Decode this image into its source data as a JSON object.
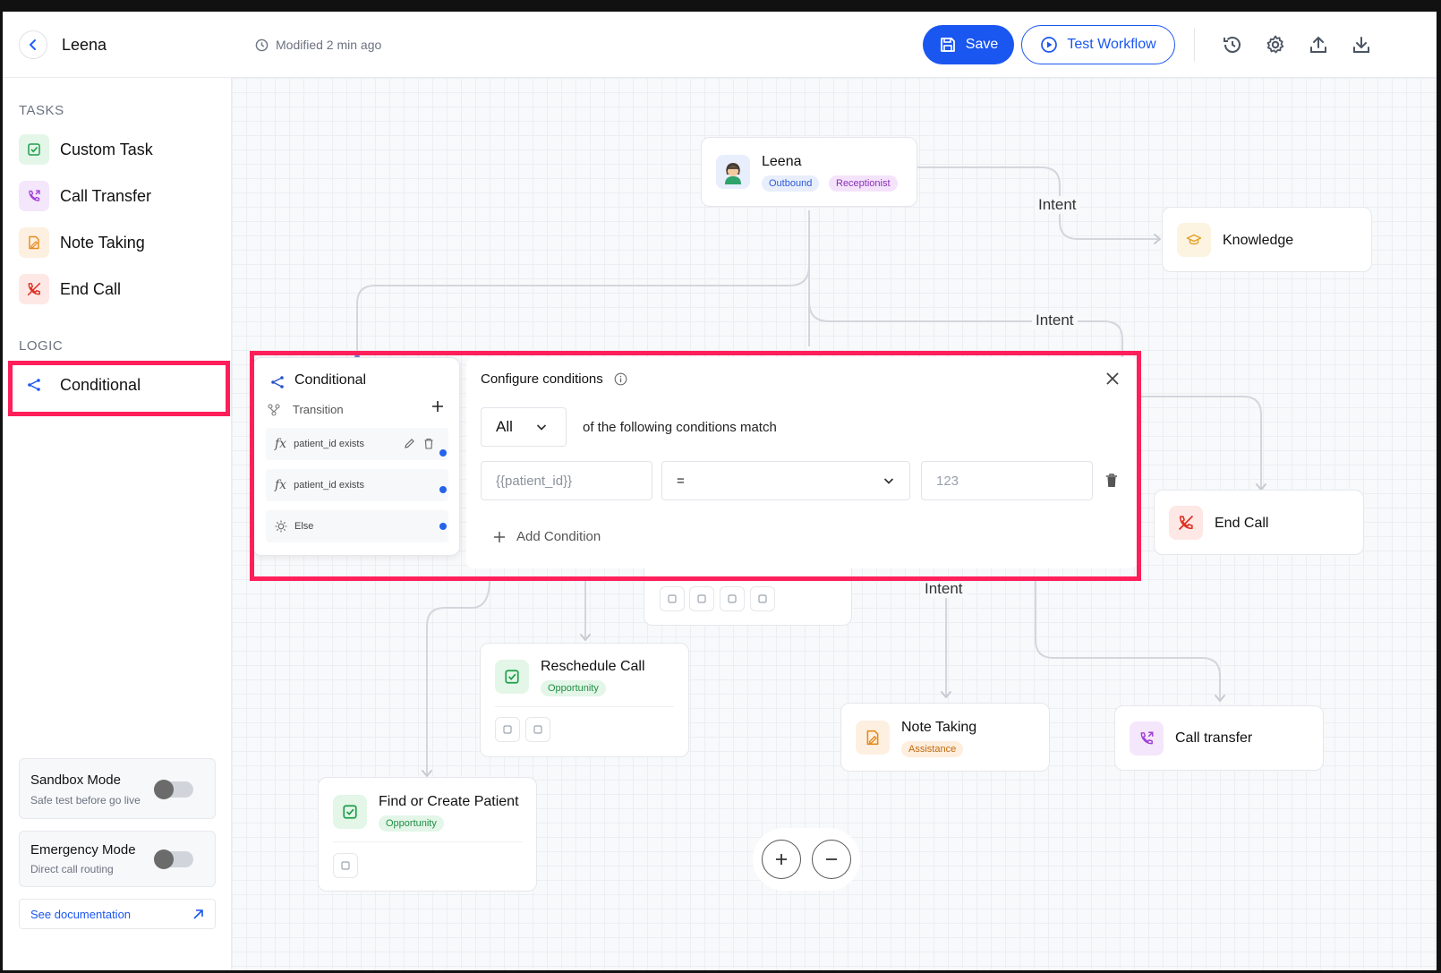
{
  "header": {
    "title": "Leena",
    "modified": "Modified 2 min ago",
    "save_label": "Save",
    "test_label": "Test Workflow"
  },
  "sidebar": {
    "tasks_label": "TASKS",
    "tasks": [
      {
        "label": "Custom Task",
        "icon": "task-check-icon"
      },
      {
        "label": "Call Transfer",
        "icon": "phone-transfer-icon"
      },
      {
        "label": "Note Taking",
        "icon": "note-icon"
      },
      {
        "label": "End Call",
        "icon": "phone-end-icon"
      }
    ],
    "logic_label": "LOGIC",
    "logic": [
      {
        "label": "Conditional",
        "icon": "branch-icon"
      }
    ],
    "sandbox": {
      "title": "Sandbox Mode",
      "subtitle": "Safe test before go live",
      "enabled": false
    },
    "emergency": {
      "title": "Emergency Mode",
      "subtitle": "Direct call routing",
      "enabled": false
    },
    "doc_link": "See documentation"
  },
  "canvas": {
    "agent": {
      "name": "Leena",
      "tags": [
        "Outbound",
        "Receptionist"
      ]
    },
    "edge_labels": [
      "Intent",
      "Intent",
      "Intent"
    ],
    "nodes": {
      "knowledge": "Knowledge",
      "end_call": "End Call",
      "reschedule": {
        "title": "Reschedule Call",
        "badge": "Opportunity"
      },
      "find_patient": {
        "title": "Find or Create Patient",
        "badge": "Opportunity"
      },
      "note_taking": {
        "title": "Note Taking",
        "badge": "Assistance"
      },
      "call_transfer": "Call transfer"
    }
  },
  "conditional": {
    "title": "Conditional",
    "transition_label": "Transition",
    "rows": [
      "patient_id exists",
      "patient_id exists",
      "Else"
    ]
  },
  "panel": {
    "title": "Configure conditions",
    "match_mode": "All",
    "match_text": "of the following conditions match",
    "condition": {
      "variable": "{{patient_id}}",
      "operator": "=",
      "value_placeholder": "123"
    },
    "add_label": "Add Condition"
  },
  "colors": {
    "primary": "#1a56f0",
    "highlight": "#ff1f5a"
  }
}
